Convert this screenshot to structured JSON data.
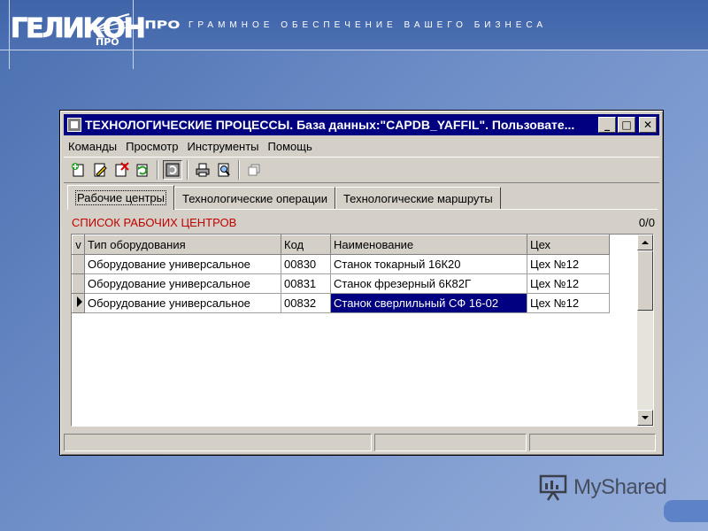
{
  "header": {
    "logo": "ГЕЛИКОН",
    "logo_sub": "ПРО",
    "tagline_prefix": "ПРО",
    "tagline": "ГРАММНОЕ ОБЕСПЕЧЕНИЕ ВАШЕГО БИЗНЕСА"
  },
  "window": {
    "title": "ТЕХНОЛОГИЧЕСКИЕ ПРОЦЕССЫ. База данных:\"CAPDB_YAFFIL\". Пользовате...",
    "buttons": {
      "minimize": "_",
      "maximize": "□",
      "close": "✕"
    },
    "menu": [
      {
        "label": "Команды"
      },
      {
        "label": "Просмотр"
      },
      {
        "label": "Инструменты"
      },
      {
        "label": "Помощь"
      }
    ],
    "toolbar_icons": [
      "add-record-icon",
      "edit-record-icon",
      "delete-record-icon",
      "refresh-icon",
      "filter-icon",
      "print-icon",
      "preview-icon",
      "copy-icon"
    ],
    "tabs": [
      {
        "label": "Рабочие центры",
        "active": true
      },
      {
        "label": "Технологические операции",
        "active": false
      },
      {
        "label": "Технологические маршруты",
        "active": false
      }
    ],
    "list": {
      "title": "СПИСОК РАБОЧИХ ЦЕНТРОВ",
      "count": "0/0",
      "indicator_header": "v",
      "columns": [
        "Тип оборудования",
        "Код",
        "Наименование",
        "Цех"
      ],
      "rows": [
        {
          "type": "Оборудование универсальное",
          "code": "00830",
          "name": "Станок токарный 16К20",
          "shop": "Цех №12",
          "current": false
        },
        {
          "type": "Оборудование универсальное",
          "code": "00831",
          "name": "Станок фрезерный 6К82Г",
          "shop": "Цех №12",
          "current": false
        },
        {
          "type": "Оборудование универсальное",
          "code": "00832",
          "name": "Станок сверлильный СФ 16-02",
          "shop": "Цех №12",
          "current": true
        }
      ]
    }
  },
  "watermark": "MyShared",
  "colors": {
    "titlebar": "#000080",
    "selection": "#000080",
    "list_title": "#c00000",
    "window_face": "#d4d0c8"
  }
}
